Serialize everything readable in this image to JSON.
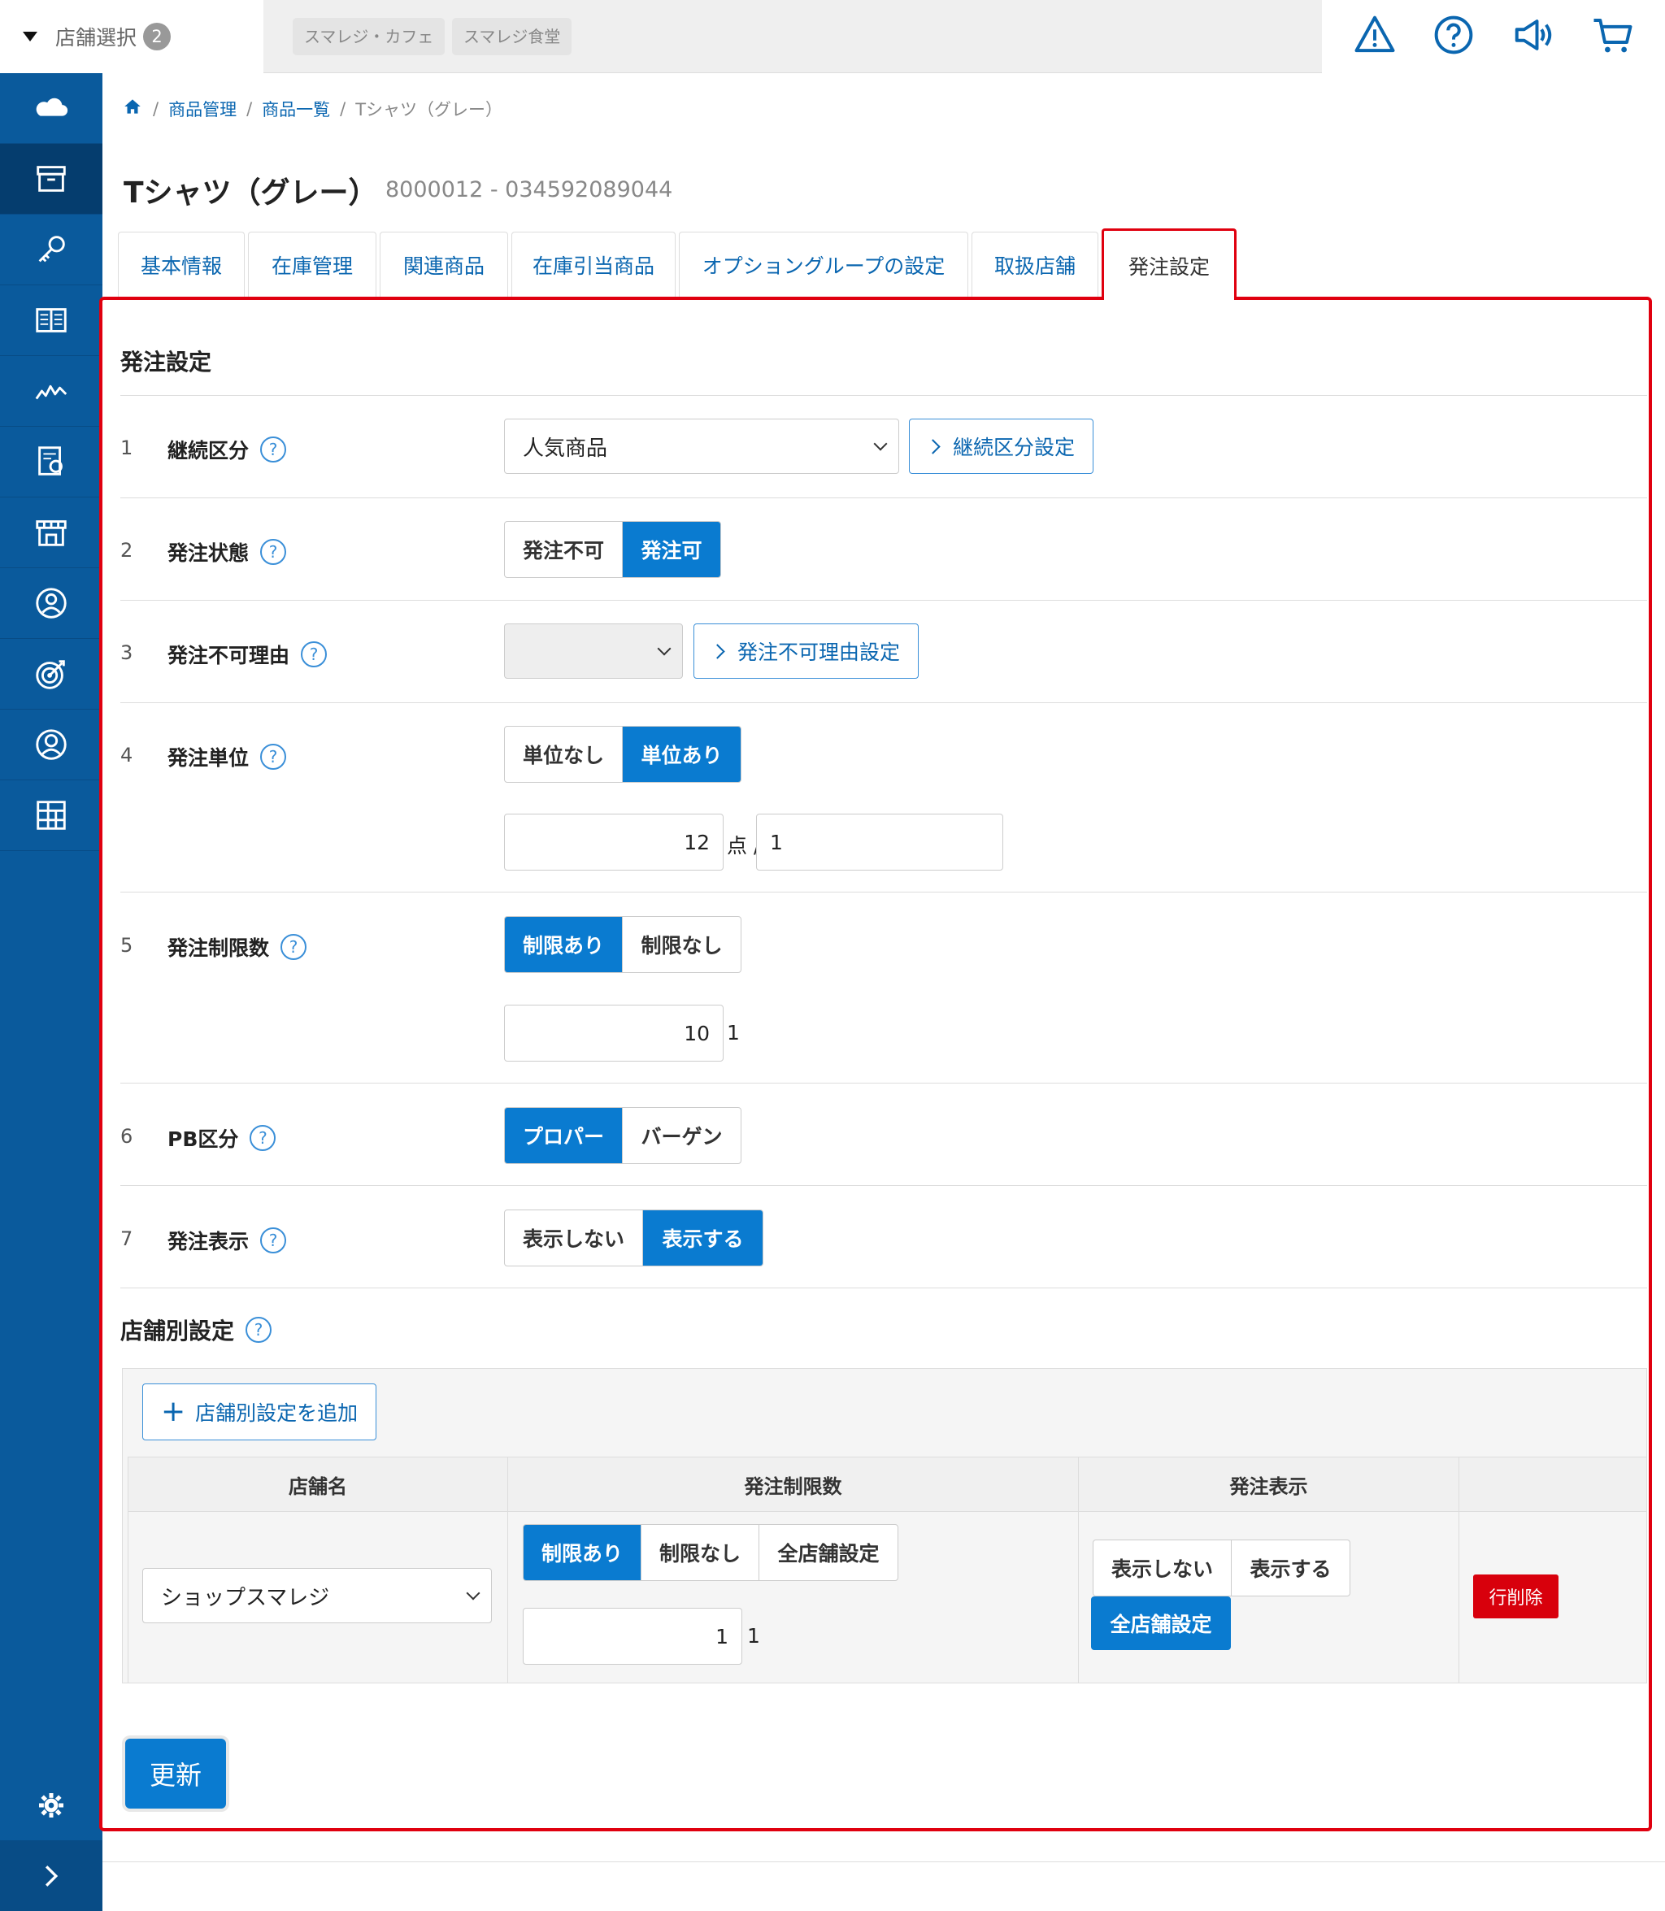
{
  "topbar": {
    "store_select_label": "店舗選択",
    "store_count": "2",
    "chips": [
      "スマレジ・カフェ",
      "スマレジ食堂"
    ],
    "icons": [
      "warning-icon",
      "help-icon",
      "megaphone-icon",
      "cart-icon"
    ]
  },
  "sidebar": {
    "items": [
      "cloud-icon",
      "archive-icon",
      "key-icon",
      "book-icon",
      "chart-line-icon",
      "report-icon",
      "store-icon",
      "user-badge-icon",
      "target-icon",
      "user-circle-icon",
      "grid-icon"
    ],
    "bottom": [
      "gear-icon",
      "chevron-right-icon"
    ]
  },
  "breadcrumb": {
    "items": [
      "商品管理",
      "商品一覧",
      "Tシャツ（グレー）"
    ]
  },
  "page": {
    "title": "Tシャツ（グレー）",
    "code": "8000012 - 034592089044"
  },
  "tabs": [
    "基本情報",
    "在庫管理",
    "関連商品",
    "在庫引当商品",
    "オプショングループの設定",
    "取扱店舗",
    "発注設定"
  ],
  "active_tab": "発注設定",
  "section": {
    "title": "発注設定",
    "rows": [
      {
        "num": "1",
        "label": "継続区分",
        "select_value": "人気商品",
        "link": "継続区分設定"
      },
      {
        "num": "2",
        "label": "発注状態",
        "options": [
          "発注不可",
          "発注可"
        ],
        "selected": "発注可"
      },
      {
        "num": "3",
        "label": "発注不可理由",
        "select_value": "",
        "link": "発注不可理由設定"
      },
      {
        "num": "4",
        "label": "発注単位",
        "options": [
          "単位なし",
          "単位あり"
        ],
        "selected": "単位あり",
        "qty": "12",
        "unit": "点 /",
        "qty2": "1"
      },
      {
        "num": "5",
        "label": "発注制限数",
        "options": [
          "制限あり",
          "制限なし"
        ],
        "selected": "制限あり",
        "qty": "10",
        "unit": "1"
      },
      {
        "num": "6",
        "label": "PB区分",
        "options": [
          "プロパー",
          "バーゲン"
        ],
        "selected": "プロパー"
      },
      {
        "num": "7",
        "label": "発注表示",
        "options": [
          "表示しない",
          "表示する"
        ],
        "selected": "表示する"
      }
    ]
  },
  "store_section": {
    "title": "店舗別設定",
    "add_button": "店舗別設定を追加",
    "columns": [
      "店舗名",
      "発注制限数",
      "発注表示",
      ""
    ],
    "row": {
      "store": "ショップスマレジ",
      "limit_options": [
        "制限あり",
        "制限なし",
        "全店舗設定"
      ],
      "limit_selected": "制限あり",
      "limit_qty": "1",
      "limit_unit": "1",
      "display_options": [
        "表示しない",
        "表示する"
      ],
      "display_all": "全店舗設定",
      "delete": "行削除"
    }
  },
  "update_button": "更新",
  "colors": {
    "primary": "#0a7bd0",
    "sidebar": "#0a5a9c",
    "highlight": "#e0000f",
    "danger": "#d8000c"
  }
}
